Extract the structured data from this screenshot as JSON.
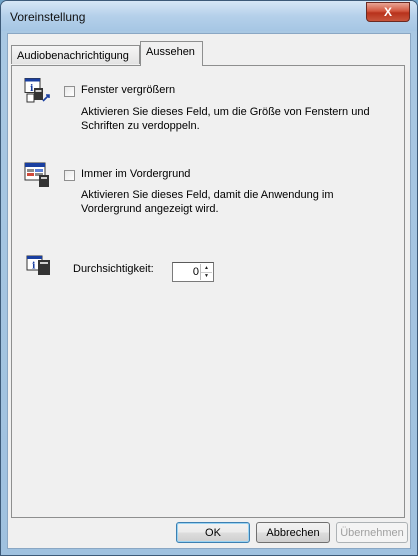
{
  "window": {
    "title": "Voreinstellung",
    "close_label": "X"
  },
  "tabs": [
    {
      "label": "Audiobenachrichtigung",
      "active": false
    },
    {
      "label": "Aussehen",
      "active": true
    }
  ],
  "options": {
    "enlarge": {
      "label": "Fenster vergrößern",
      "description": "Aktivieren Sie dieses Feld, um die Größe von Fenstern und Schriften zu verdoppeln.",
      "checked": false
    },
    "on_top": {
      "label": "Immer im Vordergrund",
      "description": "Aktivieren Sie dieses Feld, damit die Anwendung im Vordergrund angezeigt wird.",
      "checked": false
    },
    "transparency": {
      "label": "Durchsichtigkeit:",
      "value": "0"
    }
  },
  "buttons": {
    "ok": "OK",
    "cancel": "Abbrechen",
    "apply": "Übernehmen"
  },
  "icons": {
    "enlarge": "info-enlarge-icon",
    "on_top": "window-on-top-icon",
    "transparency": "info-transparency-icon"
  },
  "colors": {
    "titlebar": "#b5d0ea",
    "close": "#c8553c",
    "panel": "#f0f0f0"
  }
}
